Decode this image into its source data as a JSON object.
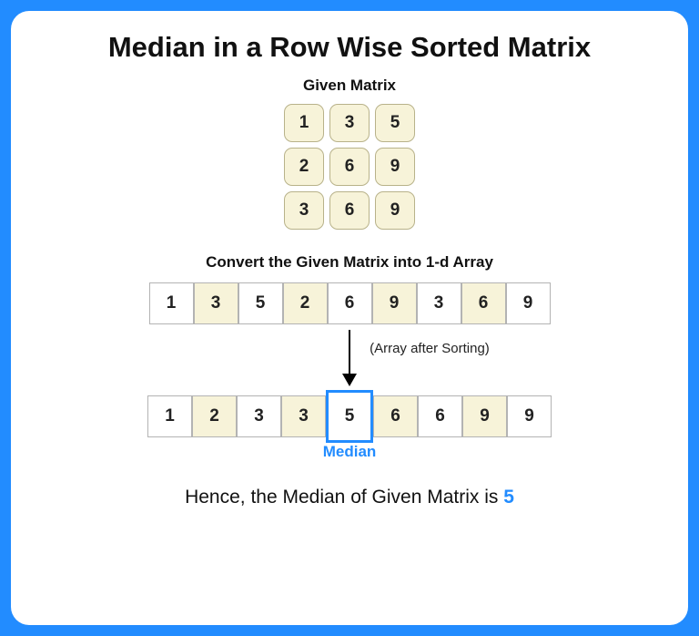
{
  "title": "Median in a Row Wise Sorted Matrix",
  "given_label": "Given Matrix",
  "matrix": [
    [
      "1",
      "3",
      "5"
    ],
    [
      "2",
      "6",
      "9"
    ],
    [
      "3",
      "6",
      "9"
    ]
  ],
  "convert_label": "Convert the Given Matrix into 1-d Array",
  "flat_array": [
    "1",
    "3",
    "5",
    "2",
    "6",
    "9",
    "3",
    "6",
    "9"
  ],
  "sort_label": "(Array after Sorting)",
  "sorted_array": [
    "1",
    "2",
    "3",
    "3",
    "5",
    "6",
    "6",
    "9",
    "9"
  ],
  "median_index": 4,
  "median_label": "Median",
  "result_prefix": "Hence, the Median of Given Matrix is ",
  "result_value": "5"
}
